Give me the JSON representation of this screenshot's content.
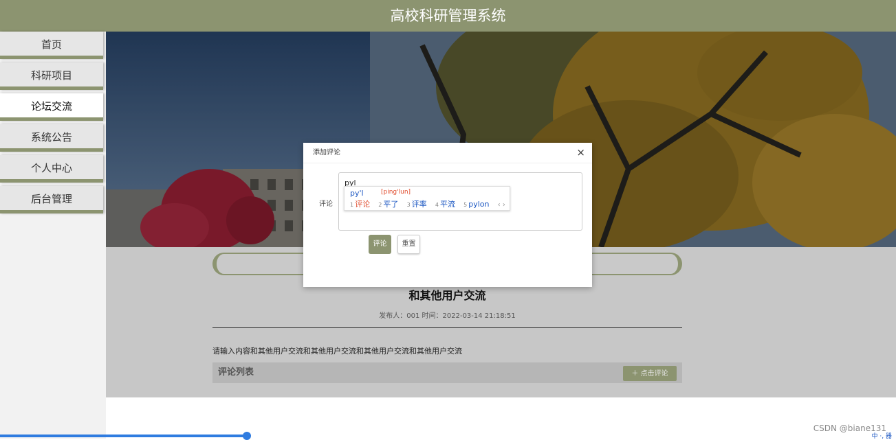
{
  "header": {
    "title": "高校科研管理系统"
  },
  "sidebar": {
    "items": [
      {
        "label": "首页",
        "active": false
      },
      {
        "label": "科研项目",
        "active": false
      },
      {
        "label": "论坛交流",
        "active": true
      },
      {
        "label": "系统公告",
        "active": false
      },
      {
        "label": "个人中心",
        "active": false
      },
      {
        "label": "后台管理",
        "active": false
      }
    ]
  },
  "post": {
    "title": "和其他用户交流",
    "meta": "发布人：001 时间：2022-03-14 21:18:51",
    "body": "请输入内容和其他用户交流和其他用户交流和其他用户交流和其他用户交流"
  },
  "comments": {
    "header": "评论列表",
    "add_button": "点击评论",
    "add_icon": "plus-icon"
  },
  "modal": {
    "title": "添加评论",
    "close_icon": "close-icon",
    "field_label": "评论",
    "textarea_value": "pyl",
    "submit_label": "评论",
    "reset_label": "重置"
  },
  "ime": {
    "composition": "py'l",
    "pinyin": "[ping'lun]",
    "candidates": [
      {
        "num": "1",
        "text": "评论"
      },
      {
        "num": "2",
        "text": "平了"
      },
      {
        "num": "3",
        "text": "评率"
      },
      {
        "num": "4",
        "text": "平流"
      },
      {
        "num": "5",
        "text": "pylon"
      }
    ],
    "arrows": "‹ ›"
  },
  "watermark": "CSDN @biane131",
  "tray": "中 ·, 器",
  "colors": {
    "accent": "#8c9470",
    "progress": "#2f7ce0"
  }
}
